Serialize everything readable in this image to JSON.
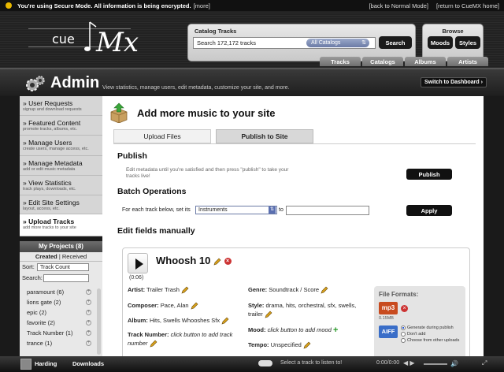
{
  "secure_bar": {
    "message": "You're using Secure Mode. All information is being encrypted.",
    "more_link": "[more]",
    "back_link": "[back to Normal Mode]",
    "return_link": "[return to CueMX home]"
  },
  "logo": {
    "cue": "cue",
    "mx": "Mx"
  },
  "catalog": {
    "label": "Catalog Tracks",
    "search_value": "Search 172,172 tracks",
    "scope": "All Catalogs",
    "search_button": "Search"
  },
  "browse": {
    "label": "Browse",
    "moods": "Moods",
    "styles": "Styles"
  },
  "nav_tabs": [
    "Tracks",
    "Catalogs",
    "Albums",
    "Artists"
  ],
  "admin": {
    "title": "Admin",
    "subtitle": "View statistics, manage users, edit metadata, customize your site, and more.",
    "dashboard_button": "Switch to Dashboard ›"
  },
  "sidebar": {
    "items": [
      {
        "label": "User Requests",
        "desc": "signup and download requests"
      },
      {
        "label": "Featured Content",
        "desc": "promote tracks, albums, etc."
      },
      {
        "label": "Manage Users",
        "desc": "create users, manage access, etc."
      },
      {
        "label": "Manage Metadata",
        "desc": "add or edit music metadata"
      },
      {
        "label": "View Statistics",
        "desc": "track plays, downloads, etc."
      },
      {
        "label": "Edit Site Settings",
        "desc": "layout, access, etc."
      },
      {
        "label": "Upload Tracks",
        "desc": "add more tracks to your site"
      }
    ]
  },
  "projects": {
    "header": "My Projects (8)",
    "tab_created": "Created",
    "tab_received": "Received",
    "sort_label": "Sort:",
    "sort_value": "Track Count",
    "search_label": "Search:",
    "items": [
      "paramount (6)",
      "lions gate (2)",
      "epic (2)",
      "favorite (2)",
      "Track Number (1)",
      "trance (1)"
    ]
  },
  "main": {
    "title": "Add more music to your site",
    "tab_upload": "Upload Files",
    "tab_publish": "Publish to Site",
    "publish_heading": "Publish",
    "publish_desc": "Edit metadata until you're satisfied and then press \"publish\" to take your tracks live!",
    "publish_button": "Publish",
    "batch_heading": "Batch Operations",
    "batch_label": "For each track below, set its",
    "batch_field": "Instruments",
    "batch_to": "to",
    "apply_button": "Apply",
    "edit_heading": "Edit fields manually"
  },
  "track": {
    "title": "Whoosh 10",
    "duration": "(0:06)",
    "artist_label": "Artist:",
    "artist": "Trailer Trash",
    "composer_label": "Composer:",
    "composer": "Pace, Alan",
    "album_label": "Album:",
    "album": "Hits, Swells Whooshes Sfx",
    "tracknum_label": "Track Number:",
    "tracknum": "click button to add track number",
    "genre_label": "Genre:",
    "genre": "Soundtrack / Score",
    "style_label": "Style:",
    "style": "drama, hits, orchestral, sfx, swells, trailer",
    "mood_label": "Mood:",
    "mood": "click button to add mood",
    "tempo_label": "Tempo:",
    "tempo": "Unspecified"
  },
  "formats": {
    "title": "File Formats:",
    "mp3": "mp3",
    "mp3_size": "0.15MB",
    "aiff": "AIFF",
    "opt1": "Generate during publish",
    "opt2": "Don't add",
    "opt3": "Choose from other uploads"
  },
  "player": {
    "user": "Harding",
    "downloads": "Downloads",
    "message": "Select a track to listen to!",
    "time": "0:00/0:00"
  }
}
